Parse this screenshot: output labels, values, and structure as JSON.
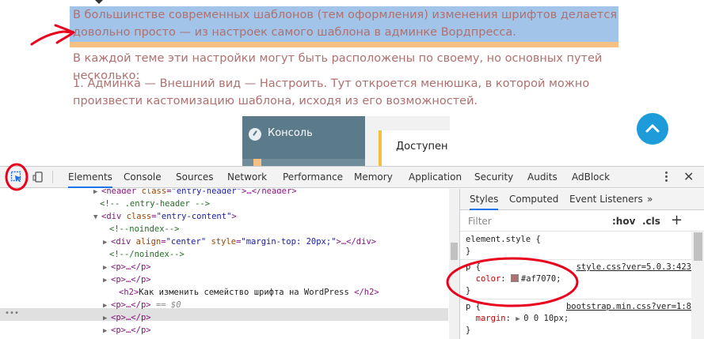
{
  "page": {
    "selected_paragraph": "В большинстве современных шаблонов (тем оформления) изменения шрифтов делается довольно просто — из настроек самого шаблона в админке Вордпресса.",
    "paragraph_2": "В каждой теме эти настройки могут быть расположены по своему, но основных путей несколько:",
    "paragraph_3": "1. Админка — Внешний вид — Настроить. Тут откроется менюшка, в которой можно произвести кастомизацию шаблона, исходя из его возможностей.",
    "embedded_screenshot": {
      "sidebar_label": "Консоль",
      "notice_text": "Доступен \\"
    },
    "scroll_top_icon": "chevron-up-icon",
    "text_color": "#af7070",
    "selection_color": "#a3c4e9"
  },
  "devtools": {
    "tabs": [
      "Elements",
      "Console",
      "Sources",
      "Network",
      "Performance",
      "Memory",
      "Application",
      "Security",
      "Audits",
      "AdBlock"
    ],
    "active_tab": "Elements",
    "dom": [
      {
        "tri": "▶",
        "tag_open": "<header",
        "attrs": [
          {
            "n": "class",
            "v": "\"entry-header\""
          }
        ],
        "rest": ">…</header>"
      },
      {
        "comment": "<!-- .entry-header -->"
      },
      {
        "tri": "▼",
        "tag_open": "<div",
        "attrs": [
          {
            "n": "class",
            "v": "\"entry-content\""
          }
        ],
        "rest": ">"
      },
      {
        "comment": "<!--noindex-->"
      },
      {
        "tri": "▶",
        "tag_open": "<div",
        "attrs": [
          {
            "n": "align",
            "v": "\"center\""
          },
          {
            "n": "style",
            "v": "\"margin-top: 20px;\""
          }
        ],
        "rest": ">…</div>"
      },
      {
        "comment": "<!--/noindex-->"
      },
      {
        "tri": "▶",
        "tag_open": "<p",
        "attrs": [],
        "rest": ">…</p>"
      },
      {
        "tri": "▶",
        "tag_open": "<p",
        "attrs": [],
        "rest": ">…</p>"
      },
      {
        "tri": "",
        "tag_open": "<h2",
        "attrs": [],
        "rest": ">",
        "text": "Как изменить семейство шрифта на WordPress ",
        "close": "</h2>"
      },
      {
        "tri": "▶",
        "tag_open": "<p",
        "attrs": [],
        "rest": ">…</p>",
        "suffix": " == $0"
      },
      {
        "tri": "▶",
        "tag_open": "<p",
        "attrs": [],
        "rest": ">…</p>"
      },
      {
        "tri": "▶",
        "tag_open": "<p",
        "attrs": [],
        "rest": ">…</p>"
      }
    ],
    "selected_dots": "•••",
    "styles_tabs": [
      "Styles",
      "Computed",
      "Event Listeners",
      "»"
    ],
    "active_styles_tab": "Styles",
    "filter_placeholder": "Filter",
    "hov": ":hov",
    "cls": ".cls",
    "plus": "+",
    "rules": {
      "element_style_open": "element.style {",
      "close": "}",
      "p_open": "p {",
      "color_prop": "color",
      "color_value": "#af7070;",
      "color_source": "style.css?ver=5.0.3:423",
      "margin_prop": "margin",
      "margin_value": "0 0 10px;",
      "margin_source": "bootstrap.min.css?ver=1:8"
    },
    "annotation_color": "#e8001c"
  }
}
